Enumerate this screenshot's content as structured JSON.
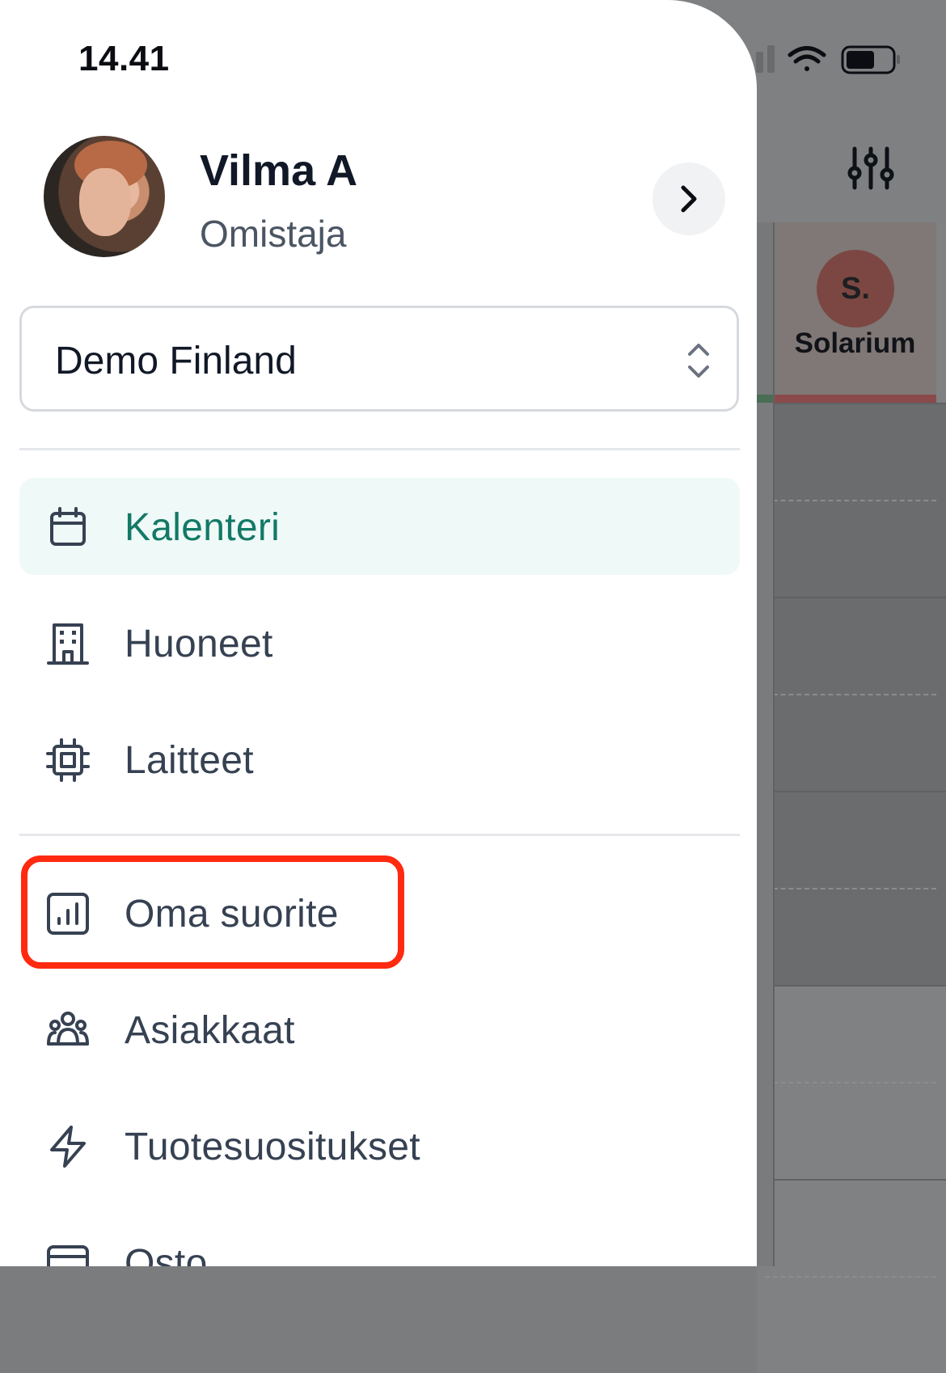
{
  "status_bar": {
    "time": "14.41"
  },
  "profile": {
    "name": "Vilma A",
    "role": "Omistaja"
  },
  "org_select": {
    "value": "Demo Finland"
  },
  "menu": {
    "items": [
      {
        "label": "Kalenteri",
        "icon": "calendar-icon",
        "active": true
      },
      {
        "label": "Huoneet",
        "icon": "building-icon",
        "active": false
      },
      {
        "label": "Laitteet",
        "icon": "chip-icon",
        "active": false
      },
      {
        "label": "Oma suorite",
        "icon": "chart-icon",
        "active": false,
        "highlighted": true
      },
      {
        "label": "Asiakkaat",
        "icon": "users-icon",
        "active": false
      },
      {
        "label": "Tuotesuositukset",
        "icon": "lightning-icon",
        "active": false
      },
      {
        "label": "Osto",
        "icon": "card-icon",
        "active": false
      }
    ]
  },
  "background": {
    "resource_column": {
      "avatar_text": "S.",
      "label": "Solarium"
    }
  },
  "colors": {
    "active_bg": "#effaf8",
    "active_text": "#137966",
    "highlight_border": "#ff2a10",
    "resource_avatar": "#7c4742"
  }
}
